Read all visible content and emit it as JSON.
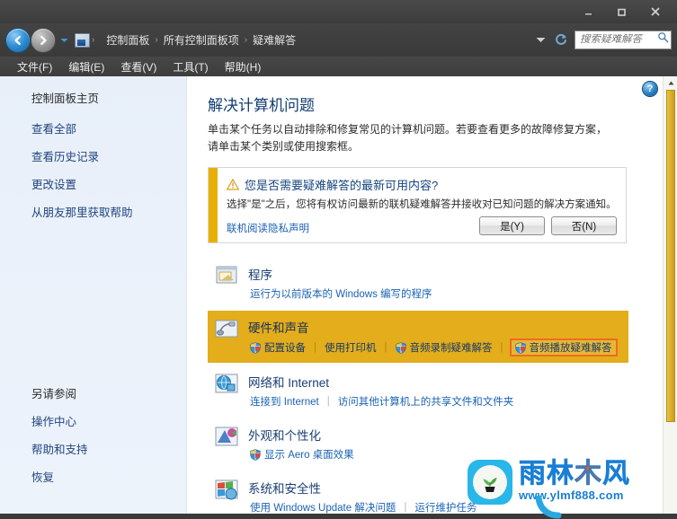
{
  "window": {
    "controls": {
      "minimize": "minimize-button",
      "maximize": "maximize-button",
      "close": "close-button"
    }
  },
  "nav": {
    "back_tooltip": "后退",
    "forward_tooltip": "前进",
    "breadcrumbs": [
      "控制面板",
      "所有控制面板项",
      "疑难解答"
    ],
    "separator": "›"
  },
  "search": {
    "placeholder": "搜索疑难解答",
    "value": ""
  },
  "menubar": {
    "items": [
      "文件(F)",
      "编辑(E)",
      "查看(V)",
      "工具(T)",
      "帮助(H)"
    ]
  },
  "sidebar": {
    "home": "控制面板主页",
    "links": [
      "查看全部",
      "查看历史记录",
      "更改设置",
      "从朋友那里获取帮助"
    ],
    "see_also_heading": "另请参阅",
    "see_also": [
      "操作中心",
      "帮助和支持",
      "恢复"
    ]
  },
  "main": {
    "help_icon_label": "?",
    "title": "解决计算机问题",
    "description": "单击某个任务以自动排除和修复常见的计算机问题。若要查看更多的故障修复方案，请单击某个类别或使用搜索框。",
    "banner": {
      "title": "您是否需要疑难解答的最新可用内容?",
      "text": "选择\"是\"之后，您将有权访问最新的联机疑难解答并接收对已知问题的解决方案通知。",
      "link": "联机阅读隐私声明",
      "yes_button": "是(Y)",
      "no_button": "否(N)",
      "stripe_color": "#e8b006"
    },
    "highlight_color": "#e3ad1b",
    "focus_outline_color": "#f06a22",
    "categories": [
      {
        "name": "程序",
        "icon": "programs-icon",
        "highlighted": false,
        "subs": [
          {
            "label": "运行为以前版本的 Windows 编写的程序",
            "shield": false,
            "focused": false
          }
        ]
      },
      {
        "name": "硬件和声音",
        "icon": "hardware-sound-icon",
        "highlighted": true,
        "subs": [
          {
            "label": "配置设备",
            "shield": true,
            "focused": false
          },
          {
            "label": "使用打印机",
            "shield": false,
            "focused": false
          },
          {
            "label": "音频录制疑难解答",
            "shield": true,
            "focused": false
          },
          {
            "label": "音频播放疑难解答",
            "shield": true,
            "focused": true
          }
        ]
      },
      {
        "name": "网络和 Internet",
        "icon": "network-internet-icon",
        "highlighted": false,
        "subs": [
          {
            "label": "连接到 Internet",
            "shield": false,
            "focused": false
          },
          {
            "label": "访问其他计算机上的共享文件和文件夹",
            "shield": false,
            "focused": false
          }
        ]
      },
      {
        "name": "外观和个性化",
        "icon": "appearance-icon",
        "highlighted": false,
        "subs": [
          {
            "label": "显示 Aero 桌面效果",
            "shield": true,
            "focused": false
          }
        ]
      },
      {
        "name": "系统和安全性",
        "icon": "system-security-icon",
        "highlighted": false,
        "subs": [
          {
            "label": "使用 Windows Update 解决问题",
            "shield": false,
            "focused": false
          },
          {
            "label": "运行维护任务",
            "shield": false,
            "focused": false
          }
        ]
      }
    ]
  },
  "watermark": {
    "chars": [
      "雨",
      "林",
      "木",
      "风"
    ],
    "url": "www.ylmf888.com",
    "brand_color": "#1a7fd4",
    "accent_color": "#f05a22"
  }
}
